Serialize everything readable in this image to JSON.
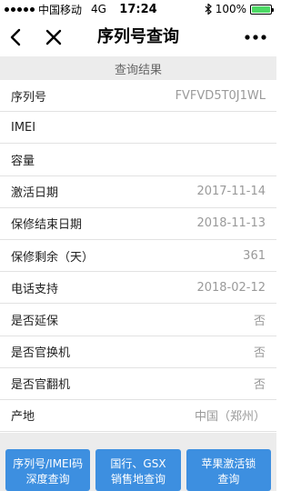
{
  "status_bar": {
    "carrier": "中国移动",
    "network": "4G",
    "time": "17:24",
    "battery_percent": "100%",
    "battery_color": "#4cd964"
  },
  "nav": {
    "title": "序列号查询",
    "back_icon": "chevron-left-icon",
    "close_icon": "close-icon",
    "more_icon": "more-dots-icon"
  },
  "section": {
    "title": "查询结果"
  },
  "rows": [
    {
      "label": "序列号",
      "value": "FVFVD5T0J1WL"
    },
    {
      "label": "IMEI",
      "value": ""
    },
    {
      "label": "容量",
      "value": ""
    },
    {
      "label": "激活日期",
      "value": "2017-11-14"
    },
    {
      "label": "保修结束日期",
      "value": "2018-11-13"
    },
    {
      "label": "保修剩余（天）",
      "value": "361"
    },
    {
      "label": "电话支持",
      "value": "2018-02-12"
    },
    {
      "label": "是否延保",
      "value": "否"
    },
    {
      "label": "是否官换机",
      "value": "否"
    },
    {
      "label": "是否官翻机",
      "value": "否"
    },
    {
      "label": "产地",
      "value": "中国（郑州）"
    }
  ],
  "actions": [
    {
      "line1": "序列号/IMEI码",
      "line2": "深度查询"
    },
    {
      "line1": "国行、GSX",
      "line2": "销售地查询"
    },
    {
      "line1": "苹果激活锁",
      "line2": "查询"
    }
  ],
  "colors": {
    "accent": "#3d8fe0",
    "section_bg": "#ececec"
  }
}
